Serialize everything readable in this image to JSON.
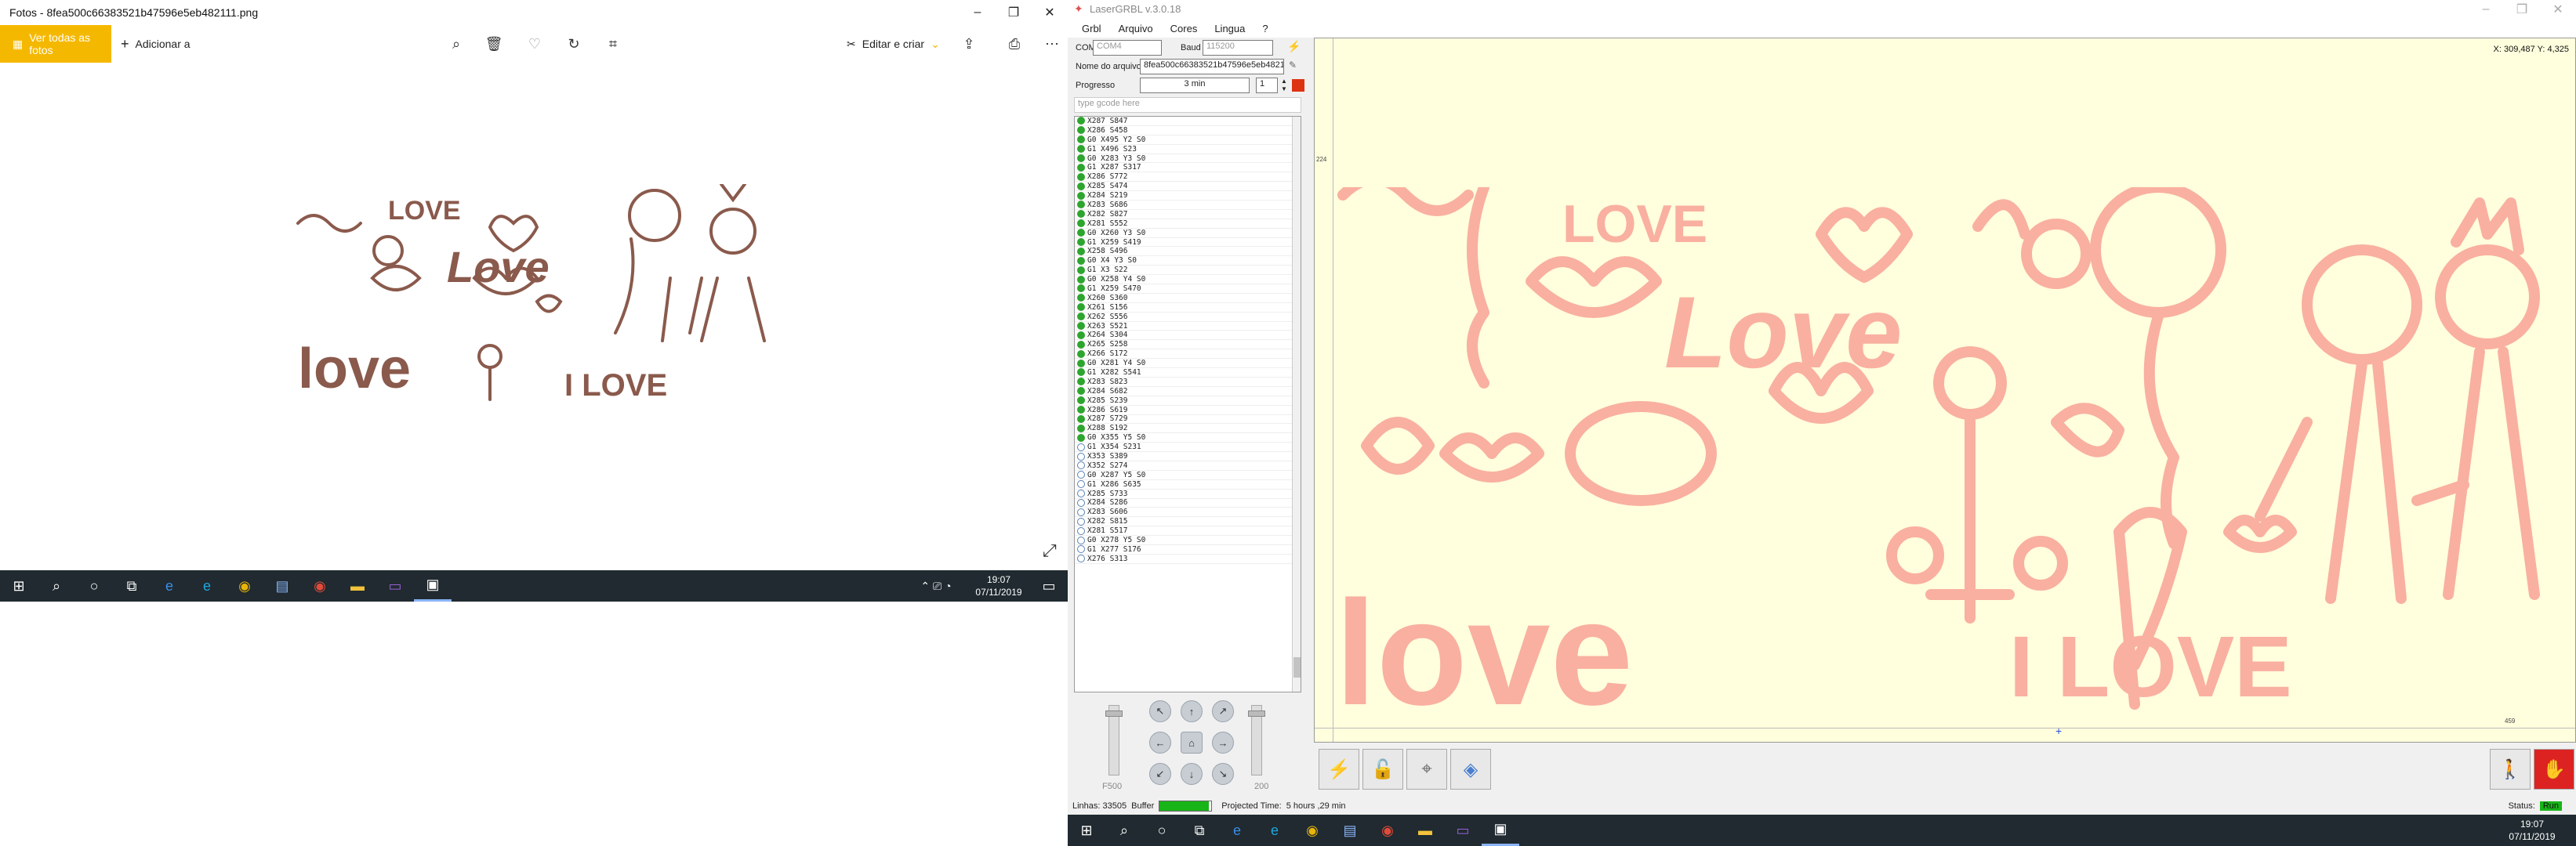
{
  "photos": {
    "title": "Fotos - 8fea500c66383521b47596e5eb482111.png",
    "see_all": "Ver todas as fotos",
    "add_to": "Adicionar a",
    "edit_create": "Editar e criar",
    "image_texts": [
      "LOVE",
      "Love",
      "love",
      "I LOVE"
    ]
  },
  "taskbar_left": {
    "time": "19:07",
    "date": "07/11/2019"
  },
  "laser": {
    "title": "LaserGRBL v.3.0.18",
    "menu": [
      "Grbl",
      "Arquivo",
      "Cores",
      "Lingua",
      "?"
    ],
    "com_label": "COM",
    "com_value": "COM4",
    "baud_label": "Baud",
    "baud_value": "115200",
    "file_label": "Nome do arquivo",
    "file_value": "8fea500c66383521b47596e5eb4821",
    "progress_label": "Progresso",
    "progress_value": "3 min",
    "copies_value": "1",
    "grbl_placeholder": "type gcode here",
    "gcode": [
      {
        "t": "X287 S847",
        "s": "done"
      },
      {
        "t": "X286 S458",
        "s": "done"
      },
      {
        "t": "G0 X495 Y2 S0",
        "s": "done"
      },
      {
        "t": "G1 X496 S23",
        "s": "done"
      },
      {
        "t": "G0 X283 Y3 S0",
        "s": "done"
      },
      {
        "t": "G1 X287 S317",
        "s": "done"
      },
      {
        "t": "X286 S772",
        "s": "done"
      },
      {
        "t": "X285 S474",
        "s": "done"
      },
      {
        "t": "X284 S219",
        "s": "done"
      },
      {
        "t": "X283 S686",
        "s": "done"
      },
      {
        "t": "X282 S827",
        "s": "done"
      },
      {
        "t": "X281 S552",
        "s": "done"
      },
      {
        "t": "G0 X260 Y3 S0",
        "s": "done"
      },
      {
        "t": "G1 X259 S419",
        "s": "done"
      },
      {
        "t": "X258 S496",
        "s": "done"
      },
      {
        "t": "G0 X4 Y3 S0",
        "s": "done"
      },
      {
        "t": "G1 X3 S22",
        "s": "done"
      },
      {
        "t": "G0 X258 Y4 S0",
        "s": "done"
      },
      {
        "t": "G1 X259 S470",
        "s": "done"
      },
      {
        "t": "X260 S360",
        "s": "done"
      },
      {
        "t": "X261 S156",
        "s": "done"
      },
      {
        "t": "X262 S556",
        "s": "done"
      },
      {
        "t": "X263 S521",
        "s": "done"
      },
      {
        "t": "X264 S304",
        "s": "done"
      },
      {
        "t": "X265 S258",
        "s": "done"
      },
      {
        "t": "X266 S172",
        "s": "done"
      },
      {
        "t": "G0 X281 Y4 S0",
        "s": "done"
      },
      {
        "t": "G1 X282 S541",
        "s": "done"
      },
      {
        "t": "X283 S823",
        "s": "done"
      },
      {
        "t": "X284 S682",
        "s": "done"
      },
      {
        "t": "X285 S239",
        "s": "done"
      },
      {
        "t": "X286 S619",
        "s": "done"
      },
      {
        "t": "X287 S729",
        "s": "done"
      },
      {
        "t": "X288 S192",
        "s": "done"
      },
      {
        "t": "G0 X355 Y5 S0",
        "s": "done"
      },
      {
        "t": "G1 X354 S231",
        "s": "pending"
      },
      {
        "t": "X353 S389",
        "s": "pending"
      },
      {
        "t": "X352 S274",
        "s": "pending"
      },
      {
        "t": "G0 X287 Y5 S0",
        "s": "pending"
      },
      {
        "t": "G1 X286 S635",
        "s": "pending"
      },
      {
        "t": "X285 S733",
        "s": "pending"
      },
      {
        "t": "X284 S286",
        "s": "pending"
      },
      {
        "t": "X283 S606",
        "s": "pending"
      },
      {
        "t": "X282 S815",
        "s": "pending"
      },
      {
        "t": "X281 S517",
        "s": "pending"
      },
      {
        "t": "G0 X278 Y5 S0",
        "s": "pending"
      },
      {
        "t": "G1 X277 S176",
        "s": "pending"
      },
      {
        "t": "X276 S313",
        "s": "pending"
      }
    ],
    "jog_speed": "F500",
    "jog_step": "200",
    "coord_readout": "X: 309,487 Y: 4,325",
    "ruler_top_mark": "224",
    "ruler_right_mark": "459",
    "status_lines": "Linhas: 33505",
    "status_buffer": "Buffer",
    "buffer_fill": 0.95,
    "status_time_label": "Projected Time:",
    "status_time": "5 hours ,29 min",
    "status_label": "Status:",
    "status_value": "Run",
    "engrave_color": "#f9b0a0",
    "bg_color": "#ffffde"
  },
  "taskbar_right": {
    "time": "19:07",
    "date": "07/11/2019"
  },
  "icons": [
    "start-icon",
    "search-icon",
    "cortana-icon",
    "taskview-icon",
    "edge-icon",
    "ie-icon",
    "chrome-icon",
    "explorer-icon",
    "photos-icon"
  ]
}
